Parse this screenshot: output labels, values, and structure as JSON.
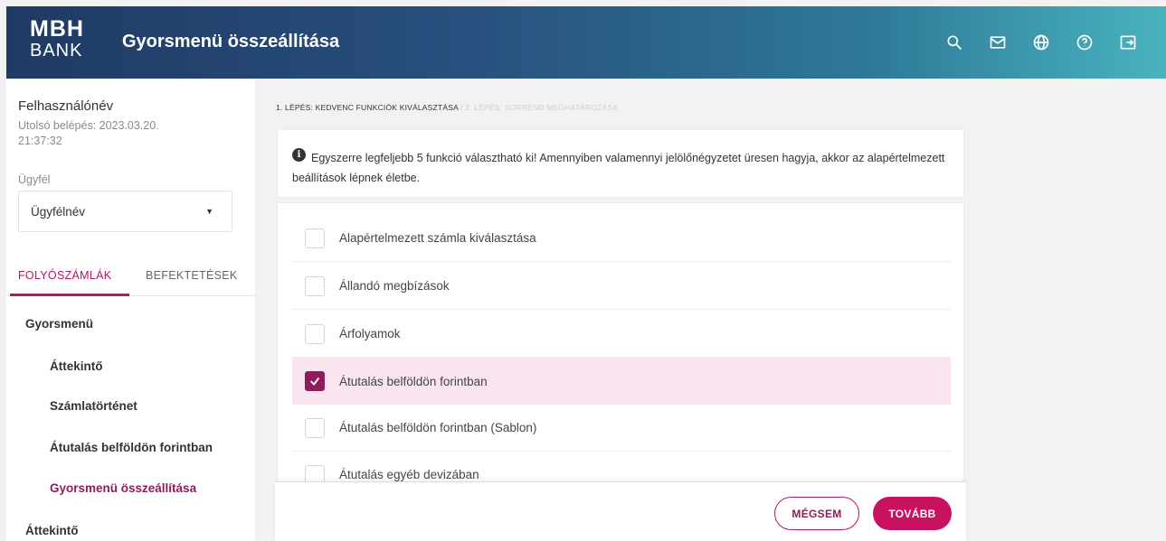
{
  "header": {
    "logo_top": "MBH",
    "logo_bottom": "BANK",
    "title": "Gyorsmenü összeállítása",
    "icons": [
      "search-icon",
      "mail-icon",
      "globe-icon",
      "help-icon",
      "logout-icon"
    ]
  },
  "sidebar": {
    "user_name": "Felhasználónév",
    "last_login": "Utolsó belépés: 2023.03.20. 21:37:32",
    "client_label": "Ügyfél",
    "client_value": "Ügyfélnév",
    "tabs": [
      "FOLYÓSZÁMLÁK",
      "BEFEKTETÉSEK"
    ],
    "menu": {
      "section": "Gyorsmenü",
      "items": [
        "Áttekintő",
        "Számlatörténet",
        "Átutalás belföldön forintban",
        "Gyorsmenü összeállítása"
      ],
      "next_section": "Áttekintő"
    }
  },
  "main": {
    "breadcrumb_step1": "1. LÉPÉS: KEDVENC FUNKCIÓK KIVÁLASZTÁSA",
    "breadcrumb_step2": "/ 2. LÉPÉS: SORREND MEGHATÁROZÁSA",
    "info_icon": "i",
    "info_text": "Egyszerre legfeljebb 5 funkció választható ki! Amennyiben valamennyi jelölőnégyzetet üresen hagyja, akkor az alapértelmezett beállítások lépnek életbe.",
    "options": [
      {
        "label": "Alapértelmezett számla kiválasztása",
        "checked": false
      },
      {
        "label": "Állandó megbízások",
        "checked": false
      },
      {
        "label": "Árfolyamok",
        "checked": false
      },
      {
        "label": "Átutalás belföldön forintban",
        "checked": true
      },
      {
        "label": "Átutalás belföldön forintban (Sablon)",
        "checked": false
      },
      {
        "label": "Átutalás egyéb devizában",
        "checked": false
      }
    ],
    "cancel_label": "MÉGSEM",
    "next_label": "TOVÁBB"
  },
  "colors": {
    "accent": "#b0186a",
    "accent_dark": "#8e1b5a",
    "primary_button": "#c8125f",
    "selected_row": "#f9e4ef"
  }
}
